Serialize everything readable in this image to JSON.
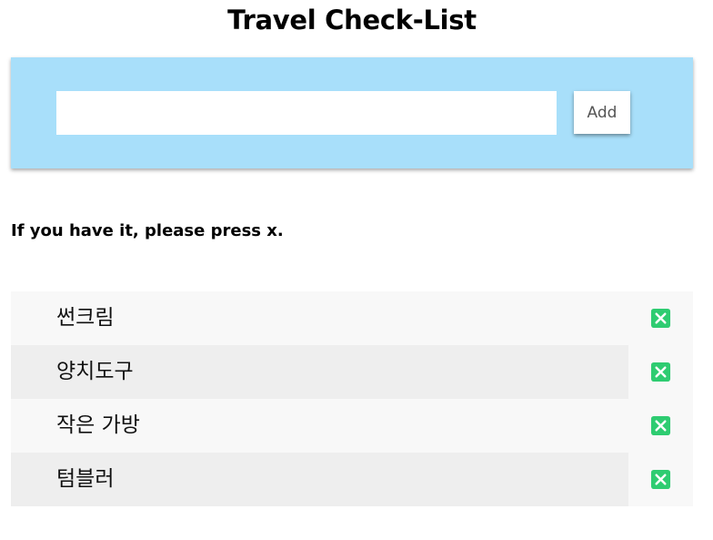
{
  "page": {
    "title": "Travel Check-List"
  },
  "form": {
    "input_value": "",
    "input_placeholder": "",
    "add_label": "Add"
  },
  "instructions": "If you have it, please press x.",
  "items": [
    {
      "label": "썬크림"
    },
    {
      "label": "양치도구"
    },
    {
      "label": "작은 가방"
    },
    {
      "label": "텀블러"
    }
  ],
  "icons": {
    "remove": "close-square-icon"
  },
  "colors": {
    "panel": "#a8dffa",
    "remove_icon": "#2ecc71",
    "row_odd": "#f8f8f8",
    "row_even": "#eeeeee"
  }
}
